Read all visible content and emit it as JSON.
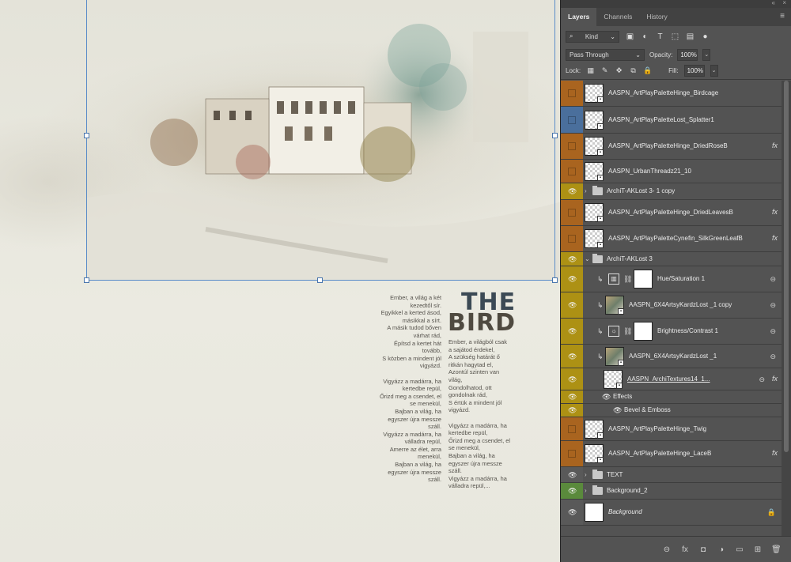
{
  "panel": {
    "tabs": [
      {
        "label": "Layers"
      },
      {
        "label": "Channels"
      },
      {
        "label": "History"
      }
    ],
    "filter_kind": "Kind",
    "blend_mode": "Pass Through",
    "opacity_label": "Opacity:",
    "opacity_value": "100%",
    "lock_label": "Lock:",
    "fill_label": "Fill:",
    "fill_value": "100%"
  },
  "layers": [
    {
      "name": "AASPN_ArtPlayPaletteHinge_Birdcage",
      "kind": "smart",
      "visible": false,
      "color": "#a9641f"
    },
    {
      "name": "AASPN_ArtPlayPaletteLost_Splatter1",
      "kind": "smart",
      "visible": false,
      "color": "#4a6f9c"
    },
    {
      "name": "AASPN_ArtPlayPaletteHinge_DriedRoseB",
      "kind": "smart",
      "visible": false,
      "color": "#a9641f",
      "fx": true
    },
    {
      "name": "AASPN_UrbanThreadz21_10",
      "kind": "smart",
      "visible": false,
      "color": "#a9641f"
    },
    {
      "name": "ArchiT-AKLost 3- 1 copy",
      "kind": "group",
      "visible": true,
      "color": "#ad9114",
      "collapsed": true
    },
    {
      "name": "AASPN_ArtPlayPaletteHinge_DriedLeavesB",
      "kind": "smart",
      "visible": false,
      "color": "#a9641f",
      "fx": true
    },
    {
      "name": "AASPN_ArtPlayPaletteCynefin_SilkGreenLeafB",
      "kind": "smart",
      "visible": false,
      "color": "#a9641f",
      "fx": true
    },
    {
      "name": "ArchiT-AKLost 3",
      "kind": "group",
      "visible": true,
      "color": "#ad9114",
      "collapsed": false
    },
    {
      "name": "Hue/Saturation 1",
      "kind": "adjust",
      "visible": true,
      "color": "#ad9114",
      "indent": true
    },
    {
      "name": "AASPN_6X4ArtsyKardzLost _1 copy",
      "kind": "photo",
      "visible": true,
      "color": "#ad9114",
      "indent": true
    },
    {
      "name": "Brightness/Contrast 1",
      "kind": "adjust2",
      "visible": true,
      "color": "#ad9114",
      "indent": true
    },
    {
      "name": "AASPN_6X4ArtsyKardzLost _1",
      "kind": "photo",
      "visible": true,
      "color": "#ad9114",
      "indent": true
    },
    {
      "name": "AASPN_ArchiTextures14_1...",
      "kind": "texture",
      "visible": true,
      "color": "#ad9114",
      "indent": true,
      "fx": true
    },
    {
      "name": "Effects",
      "kind": "effects",
      "visible": true,
      "color": "#ad9114"
    },
    {
      "name": "Bevel & Emboss",
      "kind": "effect",
      "visible": true,
      "color": "#ad9114"
    },
    {
      "name": "AASPN_ArtPlayPaletteHinge_Twig",
      "kind": "smart",
      "visible": false,
      "color": "#a9641f"
    },
    {
      "name": "AASPN_ArtPlayPaletteHinge_LaceB",
      "kind": "smart",
      "visible": false,
      "color": "#a9641f",
      "fx": true
    },
    {
      "name": "TEXT",
      "kind": "group",
      "visible": true,
      "color": "#595959",
      "collapsed": true
    },
    {
      "name": "Background_2",
      "kind": "group",
      "visible": true,
      "color": "#5a8a3c",
      "collapsed": true
    },
    {
      "name": "Background",
      "kind": "background",
      "visible": true,
      "color": "#595959",
      "locked": true
    }
  ],
  "canvas": {
    "title_the": "THE",
    "title_bird": "BIRD",
    "poem_right": "Ember, a világ a két\nkezedtől sír.\nEgyikkel a kerted ásod,\nmásikkal a sírt.\nA másik tudod bőven\nvárhat rád,\nÉpítsd a kertet hát\ntovább,\nS közben a mindent jól\nvigyázd.\n\nVigyázz a madárra, ha\nkertedbe repül,\nŐrizd meg a csendet, el\nse menekül,\nBajban a világ, ha\negyszer újra messze\nszáll.\nVigyázz a madárra, ha\nválladra repül,\nAmerre az élet, arra\nmenekül,\nBajban a világ, ha\negyszer újra messze\nszáll.",
    "poem_left": "Ember, a világból csak\na sajátod érdekel,\nA szükség határát ő\nritkán hagytad el,\nAzontúl szinten van\nvilág,\nGondolhatod, ott\ngondolnak rád,\nS értük a mindent jól\nvigyázd.\n\nVigyázz a madárra, ha\nkertedbe repül,\nŐrizd meg a csendet, el\nse menekül,\nBajban a világ, ha\negyszer újra messze\nszáll.\nVigyázz a madárra, ha\nválladra repül,..."
  }
}
